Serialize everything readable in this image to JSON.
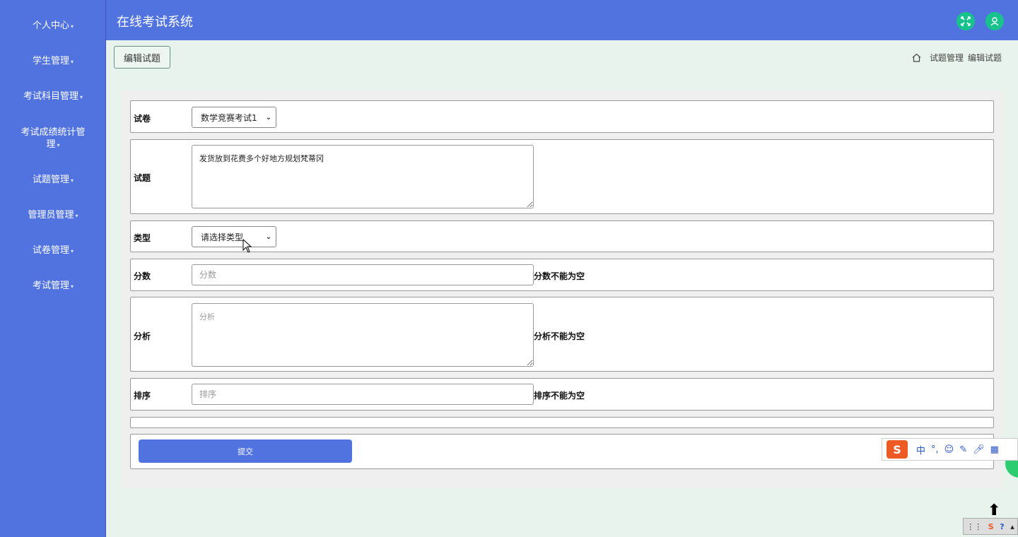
{
  "header": {
    "title": "在线考试系统"
  },
  "sidebar": {
    "items": [
      {
        "label": "个人中心"
      },
      {
        "label": "学生管理"
      },
      {
        "label": "考试科目管理"
      },
      {
        "label": "考试成绩统计管理"
      },
      {
        "label": "试题管理"
      },
      {
        "label": "管理员管理"
      },
      {
        "label": "试卷管理"
      },
      {
        "label": "考试管理"
      }
    ]
  },
  "page": {
    "tab_label": "编辑试题",
    "breadcrumb": [
      "试题管理",
      "编辑试题"
    ]
  },
  "form": {
    "paper": {
      "label": "试卷",
      "value": "数学竞赛考试1"
    },
    "question": {
      "label": "试题",
      "value": "发货放到花费多个好地方规划梵蒂冈"
    },
    "type": {
      "label": "类型",
      "value": "请选择类型"
    },
    "score": {
      "label": "分数",
      "placeholder": "分数",
      "error": "分数不能为空"
    },
    "analysis": {
      "label": "分析",
      "placeholder": "分析",
      "error": "分析不能为空"
    },
    "order": {
      "label": "排序",
      "placeholder": "排序",
      "error": "排序不能为空"
    },
    "submit_label": "提交"
  },
  "ime": {
    "mode": "中",
    "punct": "°,"
  },
  "colors": {
    "primary": "#5173e0",
    "accent": "#17c28c",
    "background": "#e8f3ee"
  }
}
